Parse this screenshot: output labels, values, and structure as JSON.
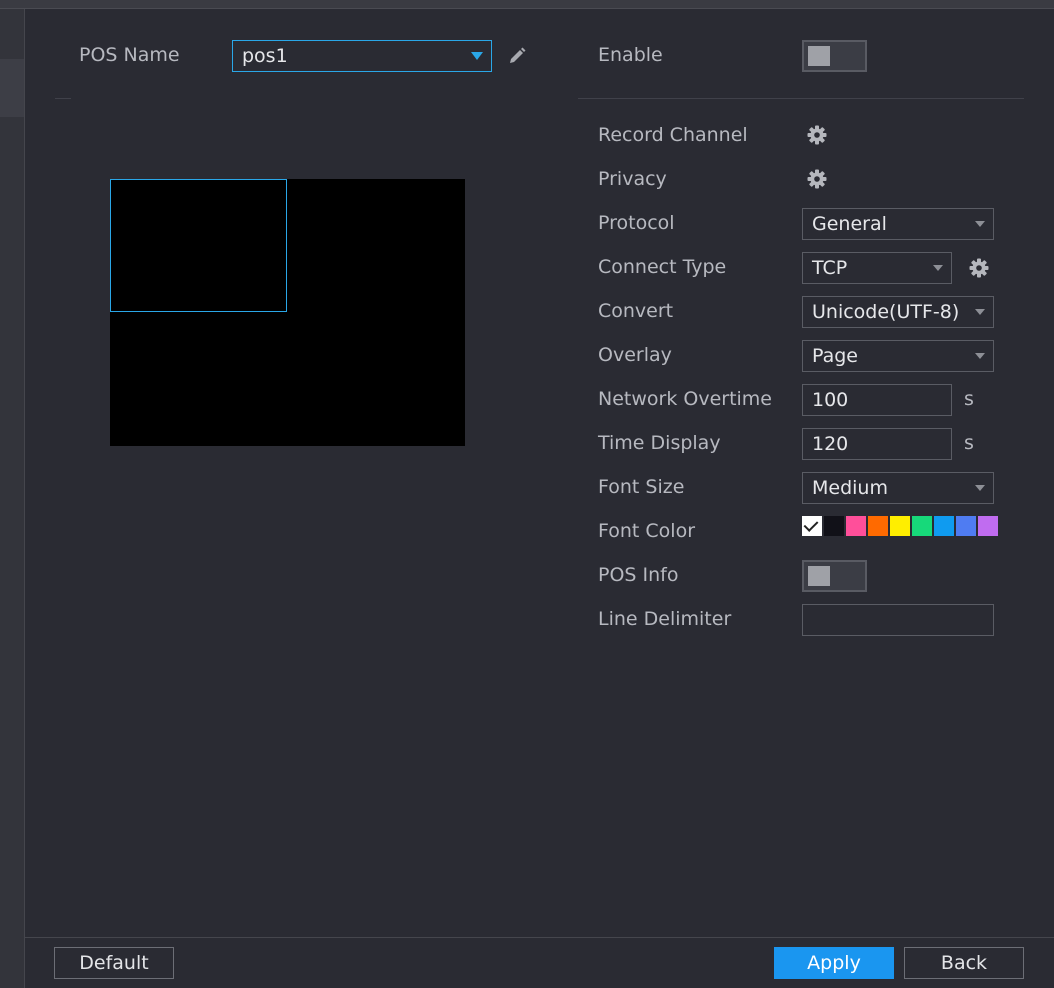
{
  "pos_name": {
    "label": "POS Name",
    "value": "pos1"
  },
  "enable": {
    "label": "Enable",
    "state": "off"
  },
  "settings": {
    "record_channel": "Record Channel",
    "privacy": "Privacy",
    "protocol": {
      "label": "Protocol",
      "value": "General"
    },
    "connect_type": {
      "label": "Connect Type",
      "value": "TCP"
    },
    "convert": {
      "label": "Convert",
      "value": "Unicode(UTF-8)"
    },
    "overlay": {
      "label": "Overlay",
      "value": "Page"
    },
    "network_overtime": {
      "label": "Network Overtime",
      "value": "100",
      "unit": "s"
    },
    "time_display": {
      "label": "Time Display",
      "value": "120",
      "unit": "s"
    },
    "font_size": {
      "label": "Font Size",
      "value": "Medium"
    },
    "font_color": {
      "label": "Font Color",
      "colors": [
        "#ffffff",
        "#111118",
        "#ff4f9a",
        "#ff6a00",
        "#ffee00",
        "#17d97a",
        "#0f9bf0",
        "#4f7cf2",
        "#c06cf0"
      ],
      "selected": "#ffffff"
    },
    "pos_info": {
      "label": "POS Info",
      "state": "off"
    },
    "line_delimiter": {
      "label": "Line Delimiter",
      "value": ""
    }
  },
  "buttons": {
    "default": "Default",
    "apply": "Apply",
    "back": "Back"
  },
  "colors": {
    "accent": "#1a96f0",
    "selection_outline": "#2aa7e8",
    "background": "#2a2b33"
  }
}
